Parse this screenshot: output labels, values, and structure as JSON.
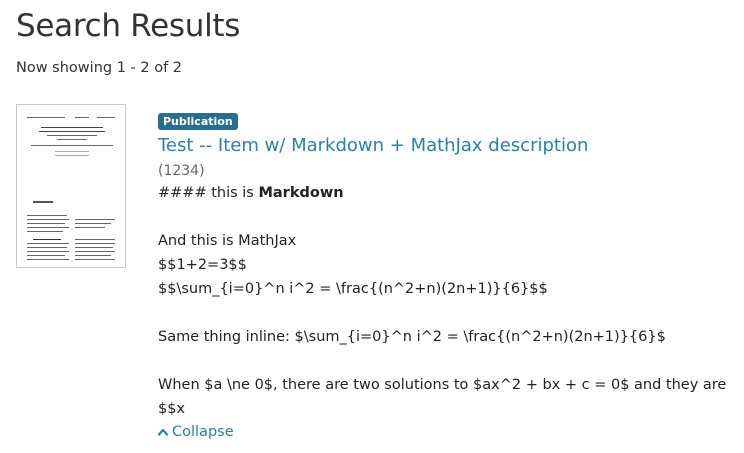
{
  "page": {
    "title": "Search Results",
    "showing": "Now showing 1 - 2 of 2"
  },
  "result": {
    "badge": "Publication",
    "title": "Test -- Item w/ Markdown + MathJax description",
    "id": "(1234)",
    "desc": {
      "line1_prefix": "#### this is ",
      "line1_bold": "Markdown",
      "line2": "And this is MathJax",
      "line3": "$$1+2=3$$",
      "line4": "$$\\sum_{i=0}^n i^2 = \\frac{(n^2+n)(2n+1)}{6}$$",
      "line5": "Same thing inline: $\\sum_{i=0}^n i^2 = \\frac{(n^2+n)(2n+1)}{6}$",
      "line6": "When $a \\ne 0$, there are two solutions to $ax^2 + bx + c = 0$ and they are",
      "line7": "$$x"
    },
    "collapse_label": "Collapse",
    "collapse_icon": "chevron-up-icon"
  }
}
